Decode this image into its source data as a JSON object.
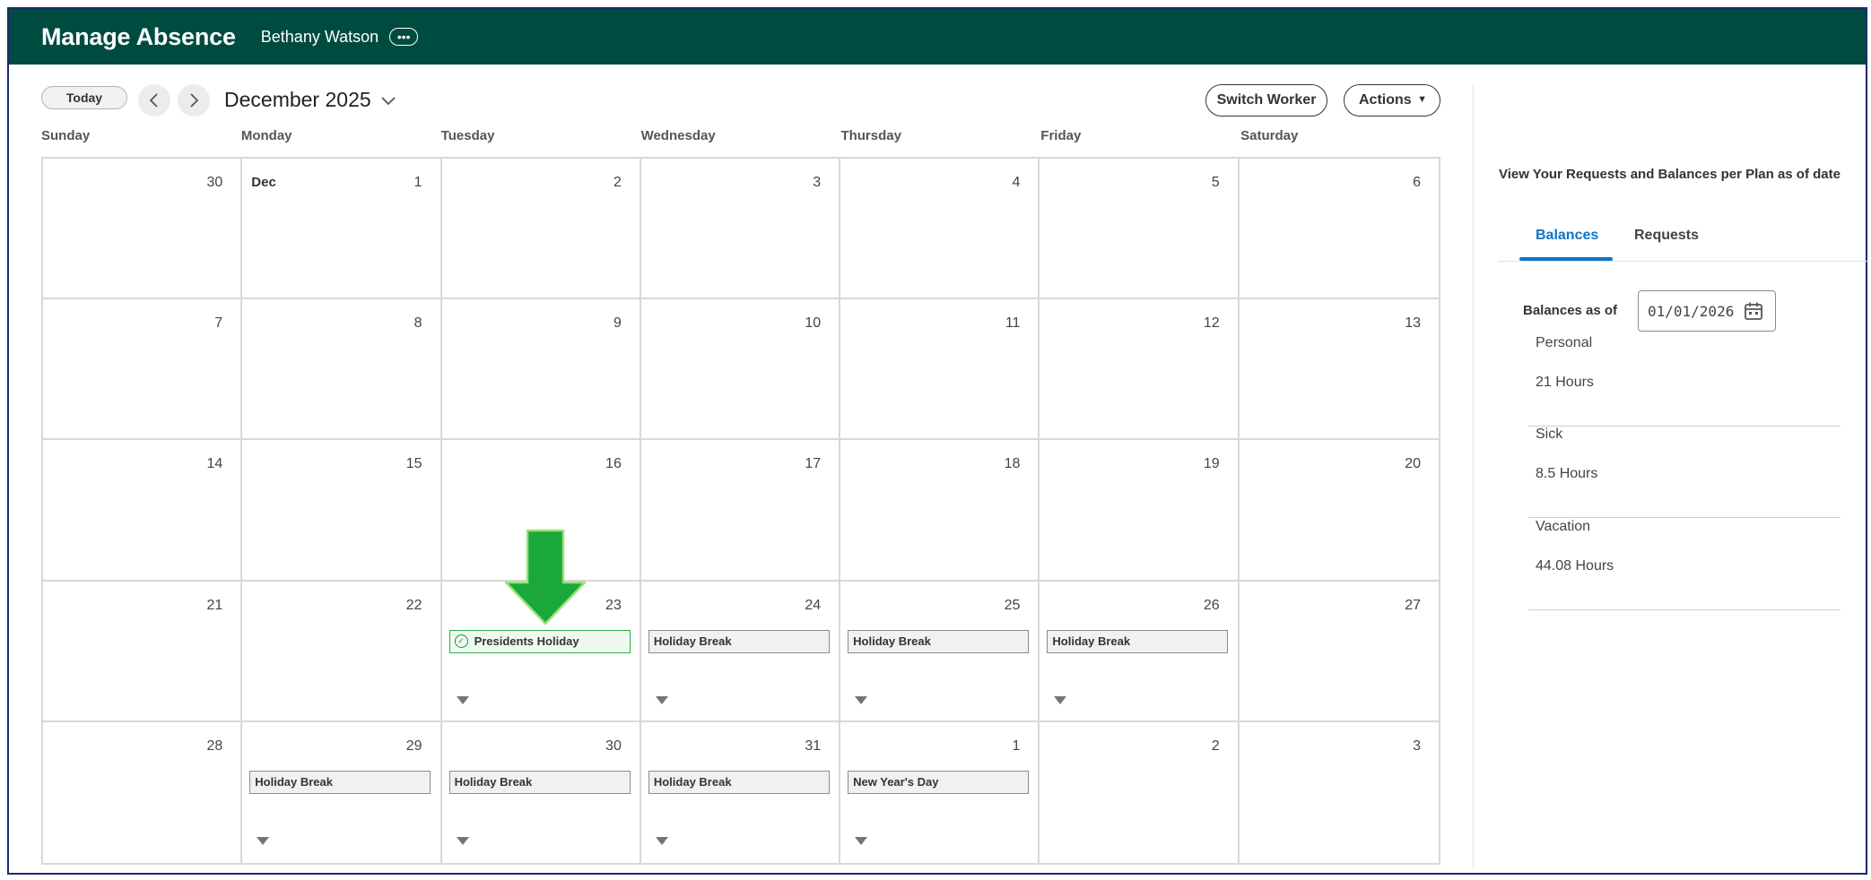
{
  "header": {
    "title": "Manage Absence",
    "worker_name": "Bethany Watson",
    "more_icon": "ellipsis-icon"
  },
  "toolbar": {
    "today_label": "Today",
    "month_label": "December 2025",
    "switch_worker_label": "Switch Worker",
    "actions_label": "Actions"
  },
  "calendar": {
    "weekdays": [
      "Sunday",
      "Monday",
      "Tuesday",
      "Wednesday",
      "Thursday",
      "Friday",
      "Saturday"
    ],
    "weeks": [
      [
        {
          "day": "30"
        },
        {
          "day": "1",
          "month_tag": "Dec"
        },
        {
          "day": "2"
        },
        {
          "day": "3"
        },
        {
          "day": "4"
        },
        {
          "day": "5"
        },
        {
          "day": "6"
        }
      ],
      [
        {
          "day": "7"
        },
        {
          "day": "8"
        },
        {
          "day": "9"
        },
        {
          "day": "10"
        },
        {
          "day": "11"
        },
        {
          "day": "12"
        },
        {
          "day": "13"
        }
      ],
      [
        {
          "day": "14"
        },
        {
          "day": "15"
        },
        {
          "day": "16"
        },
        {
          "day": "17"
        },
        {
          "day": "18"
        },
        {
          "day": "19"
        },
        {
          "day": "20"
        }
      ],
      [
        {
          "day": "21"
        },
        {
          "day": "22"
        },
        {
          "day": "23",
          "event": "Presidents Holiday",
          "approved": true
        },
        {
          "day": "24",
          "event": "Holiday Break"
        },
        {
          "day": "25",
          "event": "Holiday Break"
        },
        {
          "day": "26",
          "event": "Holiday Break"
        },
        {
          "day": "27"
        }
      ],
      [
        {
          "day": "28"
        },
        {
          "day": "29",
          "event": "Holiday Break"
        },
        {
          "day": "30",
          "event": "Holiday Break"
        },
        {
          "day": "31",
          "event": "Holiday Break"
        },
        {
          "day": "1",
          "event": "New Year's Day"
        },
        {
          "day": "2"
        },
        {
          "day": "3"
        }
      ]
    ]
  },
  "side_panel": {
    "heading": "View Your Requests and Balances per Plan as of date",
    "tabs": [
      "Balances",
      "Requests"
    ],
    "balances_as_of_label": "Balances as of",
    "date_value": "01/01/2026",
    "plans": [
      {
        "name": "Personal",
        "hours": "21 Hours"
      },
      {
        "name": "Sick",
        "hours": "8.5 Hours"
      },
      {
        "name": "Vacation",
        "hours": "44.08 Hours"
      }
    ]
  },
  "colors": {
    "header_bg": "#004b40",
    "active_tab": "#0b75c9",
    "approved_border": "#2db042",
    "annotation_arrow": "#1aa83a"
  }
}
